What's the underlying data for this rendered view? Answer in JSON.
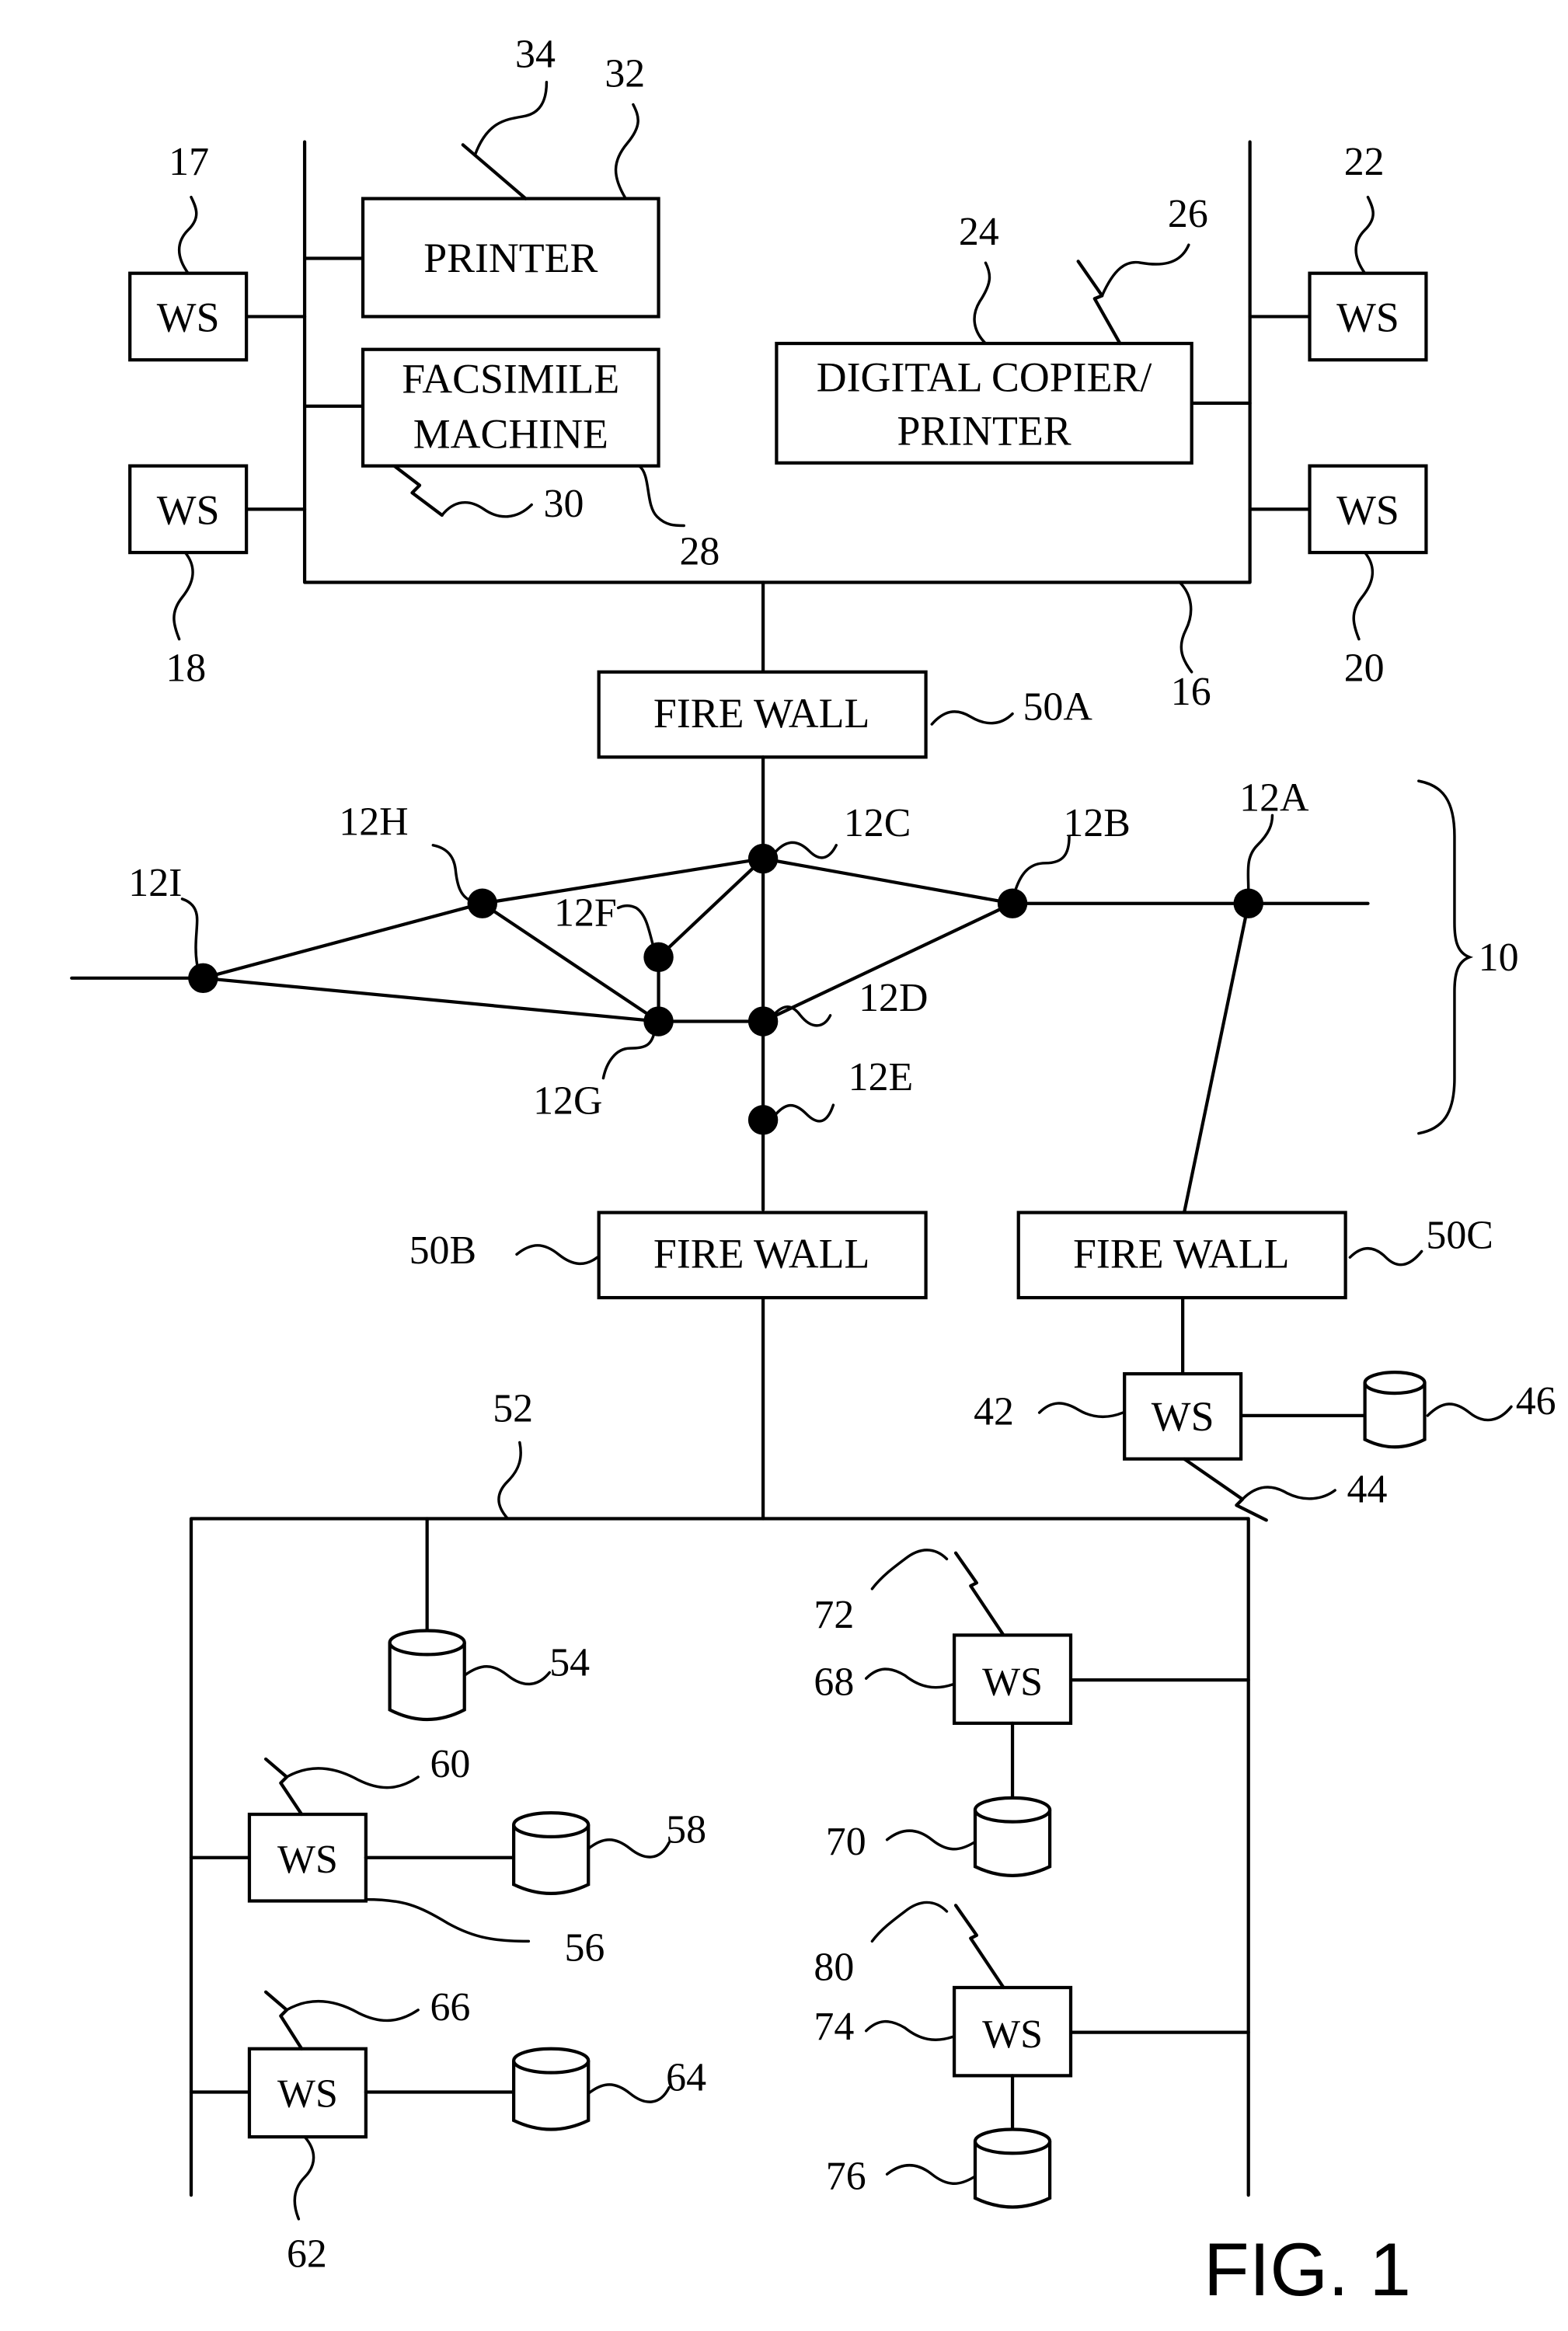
{
  "figure": {
    "caption": "FIG. 1"
  },
  "top_lan": {
    "ref": "16",
    "printer": {
      "label": "PRINTER",
      "ref": "32",
      "wireless_ref": "34"
    },
    "fax": {
      "label_line1": "FACSIMILE",
      "label_line2": "MACHINE",
      "ref": "28",
      "wireless_ref": "30"
    },
    "copier": {
      "label_line1": "DIGITAL COPIER/",
      "label_line2": "PRINTER",
      "ref": "24",
      "wireless_ref": "26"
    },
    "workstations": [
      {
        "label": "WS",
        "ref": "17"
      },
      {
        "label": "WS",
        "ref": "18"
      },
      {
        "label": "WS",
        "ref": "22"
      },
      {
        "label": "WS",
        "ref": "20"
      }
    ]
  },
  "firewalls": [
    {
      "label": "FIRE WALL",
      "ref": "50A"
    },
    {
      "label": "FIRE WALL",
      "ref": "50B"
    },
    {
      "label": "FIRE WALL",
      "ref": "50C"
    }
  ],
  "network": {
    "ref": "10",
    "nodes": [
      "12A",
      "12B",
      "12C",
      "12D",
      "12E",
      "12F",
      "12G",
      "12H",
      "12I"
    ]
  },
  "remote_ws": {
    "label": "WS",
    "ref": "42",
    "wireless_ref": "44",
    "storage_ref": "46"
  },
  "bottom_lan": {
    "ref": "52",
    "storage_ref": "54",
    "workstations": [
      {
        "label": "WS",
        "ref": "56",
        "wireless_ref": "60",
        "storage_ref": "58"
      },
      {
        "label": "WS",
        "ref": "62",
        "wireless_ref": "66",
        "storage_ref": "64"
      },
      {
        "label": "WS",
        "ref": "68",
        "wireless_ref": "72",
        "storage_ref": "70"
      },
      {
        "label": "WS",
        "ref": "74",
        "wireless_ref": "80",
        "storage_ref": "76"
      }
    ]
  }
}
